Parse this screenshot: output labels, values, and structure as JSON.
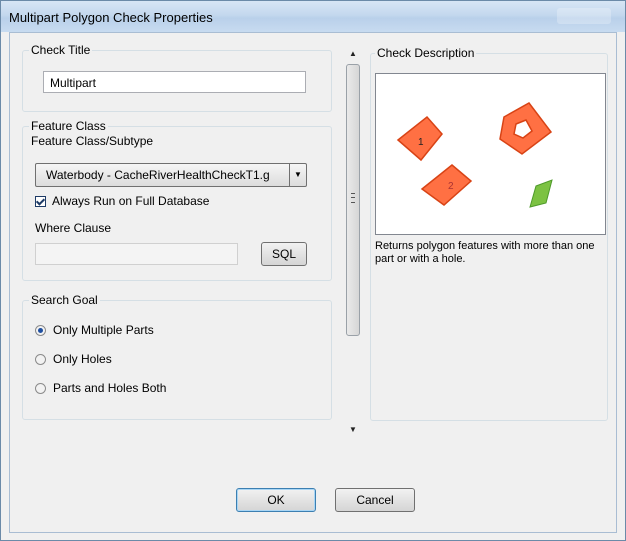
{
  "window": {
    "title": "Multipart Polygon Check Properties"
  },
  "check_title": {
    "label": "Check Title",
    "value": "Multipart"
  },
  "feature_class": {
    "label": "Feature Class",
    "subtype_label": "Feature Class/Subtype",
    "selected": "Waterbody -  CacheRiverHealthCheckT1.g",
    "always_run_label": "Always Run on Full Database",
    "always_run_checked": true,
    "where_clause_label": "Where Clause",
    "where_clause_value": "",
    "sql_button": "SQL"
  },
  "search_goal": {
    "label": "Search Goal",
    "options": [
      {
        "label": "Only Multiple Parts",
        "selected": true
      },
      {
        "label": "Only Holes",
        "selected": false
      },
      {
        "label": "Parts and Holes Both",
        "selected": false
      }
    ]
  },
  "description": {
    "label": "Check Description",
    "text": "Returns polygon features with more than one part or with a hole.",
    "diagram_labels": [
      "1",
      "2"
    ],
    "colors": {
      "feature_fill": "#ff7043",
      "feature_stroke": "#d84315",
      "other_fill": "#7cc242"
    }
  },
  "buttons": {
    "ok": "OK",
    "cancel": "Cancel"
  }
}
